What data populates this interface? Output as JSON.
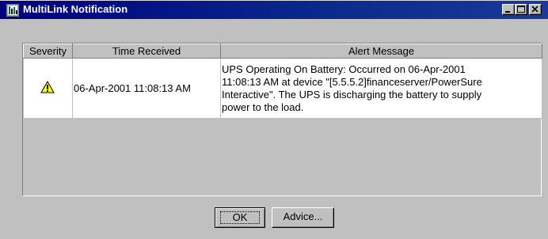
{
  "window": {
    "title": "MultiLink Notification",
    "app_icon": "multilink-app-icon",
    "controls": {
      "minimize_icon": "minimize-icon",
      "maximize_icon": "maximize-icon",
      "close_icon": "close-icon"
    }
  },
  "table": {
    "columns": [
      "Severity",
      "Time Received",
      "Alert Message"
    ],
    "rows": [
      {
        "severity_icon": "warning-icon",
        "time_received": "06-Apr-2001 11:08:13 AM",
        "message_lines": [
          "UPS Operating On Battery: Occurred on 06-Apr-2001",
          "11:08:13 AM at device \"[5.5.5.2]financeserver/PowerSure",
          "Interactive\". The UPS is discharging the battery to supply",
          "power to the load."
        ]
      }
    ]
  },
  "buttons": {
    "ok_label": "OK",
    "advice_label": "Advice..."
  },
  "colors": {
    "titlebar": "#000080",
    "window_face": "#c0c0c0",
    "warning_fill": "#ffff00"
  }
}
